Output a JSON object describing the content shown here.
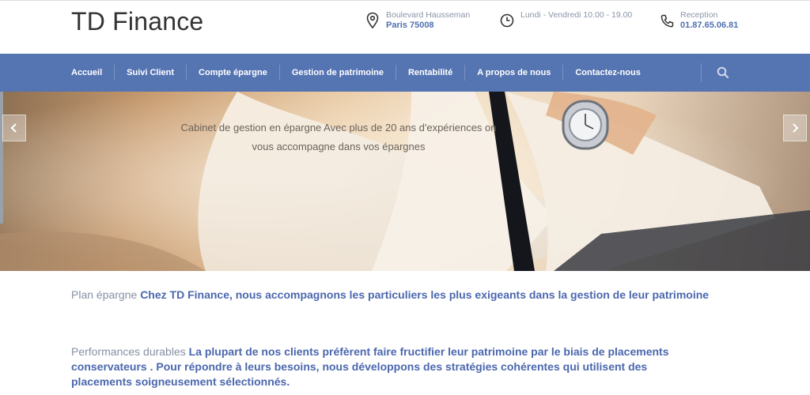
{
  "brand": {
    "name": "TD Finance"
  },
  "header": {
    "address": {
      "line1": "Boulevard Hausseman",
      "line2": "Paris 75008",
      "icon": "map-pin-icon"
    },
    "hours": {
      "line1": "Lundi - Vendredi 10.00 - 19.00",
      "icon": "clock-icon"
    },
    "phone": {
      "line1": "Reception",
      "line2": "01.87.65.06.81",
      "icon": "phone-icon"
    }
  },
  "nav": {
    "items": [
      {
        "label": "Accueil"
      },
      {
        "label": "Suivi Client"
      },
      {
        "label": "Compte épargne"
      },
      {
        "label": "Gestion de patrimoine"
      },
      {
        "label": "Rentabilité"
      },
      {
        "label": "A propos de nous"
      },
      {
        "label": "Contactez-nous"
      }
    ],
    "search_icon": "search-icon"
  },
  "hero": {
    "caption": "Cabinet de gestion en épargne Avec plus de 20 ans d'expériences on vous accompagne dans vos épargnes",
    "prev_icon": "chevron-left-icon",
    "next_icon": "chevron-right-icon"
  },
  "content": {
    "p1": {
      "kicker": "Plan épargne",
      "text": "Chez TD Finance, nous accompagnons les particuliers les plus exigeants dans la gestion de leur patrimoine"
    },
    "p2": {
      "kicker": "Performances durables",
      "text": "La plupart de nos clients préfèrent faire fructifier leur patrimoine par le biais de placements conservateurs . Pour répondre à leurs besoins, nous développons des stratégies cohérentes qui utilisent des placements soigneusement sélectionnés."
    }
  },
  "colors": {
    "nav_bg": "#5574b2",
    "accent": "#4a67ad",
    "muted": "#8590a4"
  }
}
